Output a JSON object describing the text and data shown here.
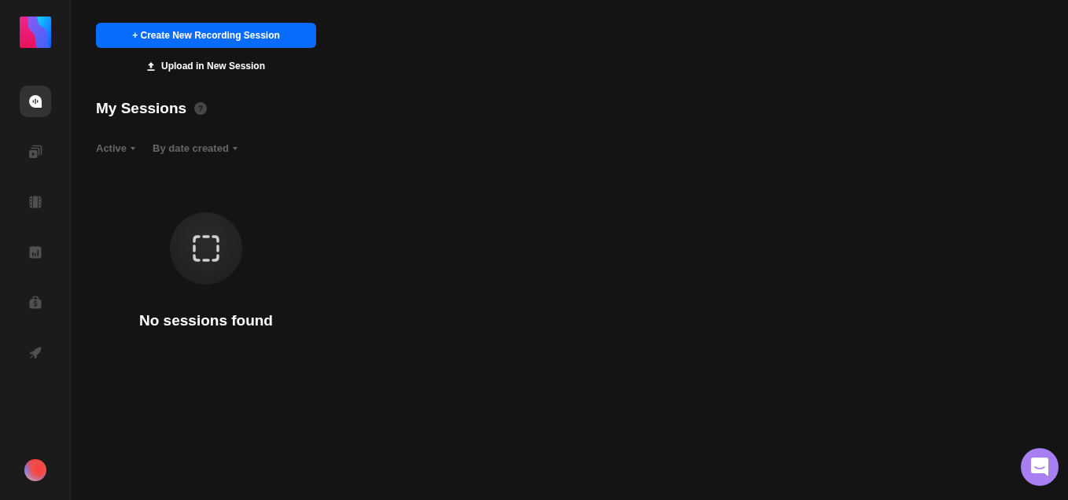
{
  "sidebar": {
    "nav_items": [
      {
        "selected": true
      },
      {
        "selected": false
      },
      {
        "selected": false
      },
      {
        "selected": false
      },
      {
        "selected": false
      },
      {
        "selected": false
      }
    ]
  },
  "main": {
    "create_button": "+ Create New Recording Session",
    "upload_link": "Upload in New Session",
    "title": "My Sessions",
    "help_badge": "?",
    "filters": [
      {
        "label": "Active"
      },
      {
        "label": "By date created"
      }
    ],
    "empty_state": {
      "message": "No sessions found"
    }
  }
}
